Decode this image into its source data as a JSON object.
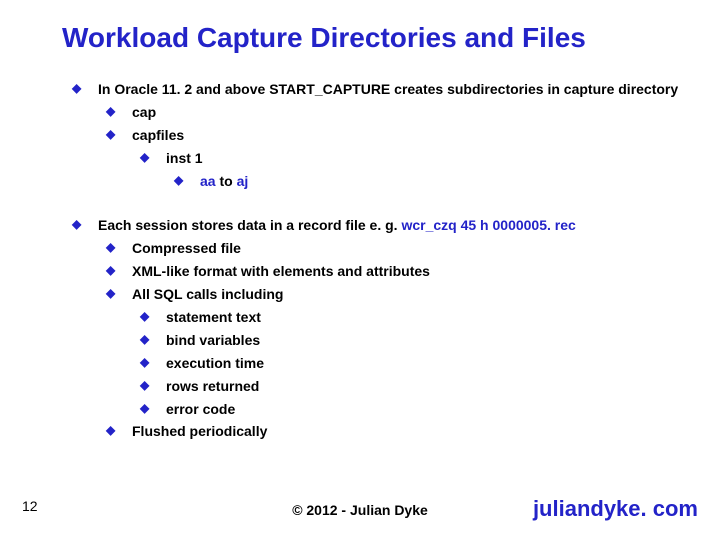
{
  "slide": {
    "title": "Workload Capture Directories and Files",
    "page_number": "12",
    "copyright": "© 2012 - Julian Dyke",
    "site": "juliandyke. com"
  },
  "block1": {
    "line1": "In Oracle 11. 2 and above START_CAPTURE creates subdirectories in capture directory",
    "sub1": "cap",
    "sub2": "capfiles",
    "sub2a": "inst 1",
    "sub2a1_a": "aa",
    "sub2a1_b": " to ",
    "sub2a1_c": "aj"
  },
  "block2": {
    "line1_a": "Each session stores  data in a record file e. g. ",
    "line1_b": "wcr_czq 45 h 0000005. rec",
    "sub1": "Compressed file",
    "sub2": "XML-like format with elements and attributes",
    "sub3": "All SQL calls including",
    "sub3a": "statement text",
    "sub3b": "bind variables",
    "sub3c": "execution time",
    "sub3d": "rows returned",
    "sub3e": "error code",
    "sub4": "Flushed periodically"
  }
}
